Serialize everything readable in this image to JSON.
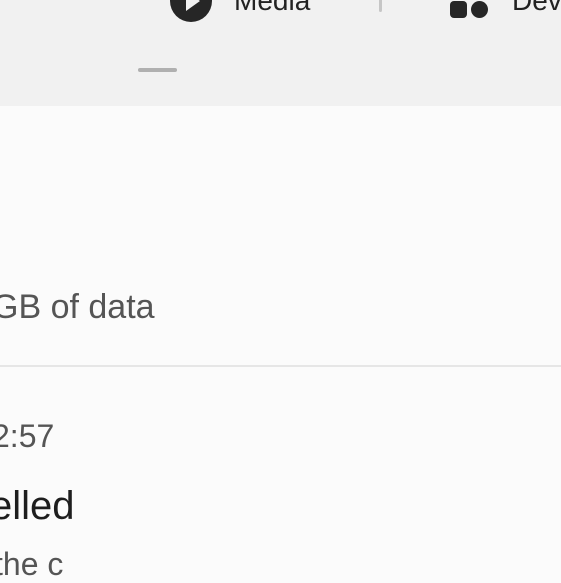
{
  "quick_panel": {
    "media_label": "Media",
    "devices_label": "Dev"
  },
  "summary": {
    "data_text": "GB of data"
  },
  "entry": {
    "time": "2:57",
    "status": "elled",
    "detail": "the c"
  }
}
